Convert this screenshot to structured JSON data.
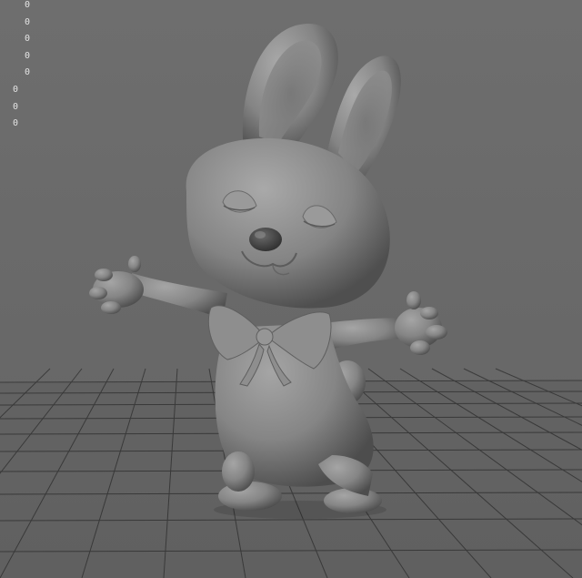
{
  "viewport": {
    "background": "#6b6b6b",
    "grid_color": "#3f3f3f"
  },
  "hud": {
    "column_1": [
      "0",
      "0",
      "0",
      "0",
      "0"
    ],
    "column_2": [
      "0",
      "0",
      "0"
    ]
  },
  "model": {
    "subject": "bunny-sculpt",
    "material_color": "#8a8a8a"
  }
}
